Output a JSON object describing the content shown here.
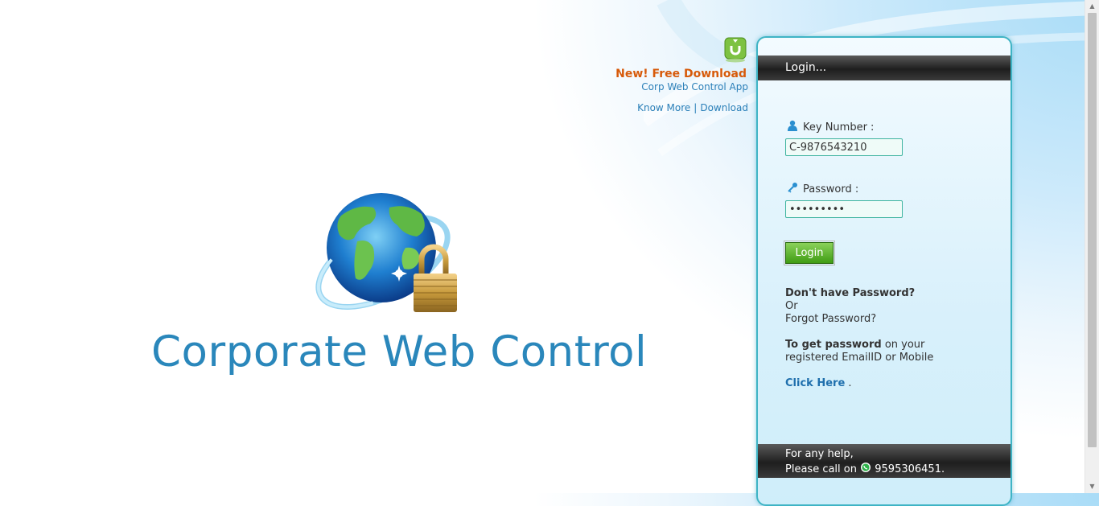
{
  "promo": {
    "title": "New! Free Download",
    "subtitle": "Corp Web Control App",
    "know_more": "Know More",
    "separator": "|",
    "download": "Download",
    "icon": "download-arrow-icon"
  },
  "brand": {
    "title": "Corporate Web Control",
    "logo": "globe-padlock-logo"
  },
  "login": {
    "header": "Login...",
    "key_label": "Key Number :",
    "key_value": "C-9876543210",
    "password_label": "Password :",
    "password_value": "secret123",
    "button": "Login",
    "no_password": "Don't have Password?",
    "or": "Or",
    "forgot": "Forgot Password?",
    "get_password_bold": "To get password",
    "get_password_rest": " on your",
    "get_password_line2": "registered EmailID or Mobile",
    "click_here": "Click Here",
    "click_here_suffix": " .",
    "help_line1": "For any help,",
    "help_call": "Please call on",
    "help_phone": "9595306451."
  },
  "colors": {
    "brand_blue": "#2a87bb",
    "promo_orange": "#d75a0a",
    "link_blue": "#2a7fb8",
    "panel_border": "#3fb4c5",
    "login_green": "#3f9d14"
  }
}
